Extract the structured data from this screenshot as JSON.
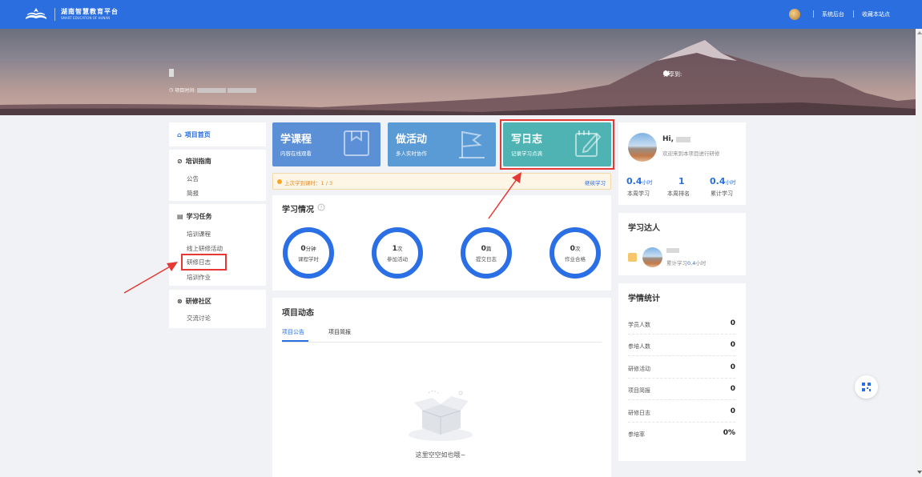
{
  "header": {
    "logo_title": "湖南智慧教育平台",
    "logo_subtitle": "SMART EDUCATION OF HUNAN",
    "links": [
      "系统后台",
      "收藏本站点"
    ]
  },
  "banner": {
    "project_time_label": "项目时间:",
    "share_label": "分享到:"
  },
  "sidebar": {
    "home": "项目首页",
    "sections": [
      {
        "title": "培训指南",
        "items": [
          "公告",
          "简报"
        ]
      },
      {
        "title": "学习任务",
        "items": [
          "培训课程",
          "线上研修活动",
          "研修日志",
          "培训作业"
        ]
      },
      {
        "title": "研修社区",
        "items": [
          "交流讨论"
        ]
      }
    ]
  },
  "tiles": [
    {
      "title": "学课程",
      "subtitle": "内容在线观看",
      "color": "#5b8fd6",
      "icon": "book-icon"
    },
    {
      "title": "做活动",
      "subtitle": "多人实时协作",
      "color": "#5b9bd5",
      "icon": "flag-icon"
    },
    {
      "title": "写日志",
      "subtitle": "记录学习点滴",
      "color": "#4fb3b3",
      "icon": "edit-icon"
    }
  ],
  "notice": {
    "text": "上次学到课时：1 / 3",
    "link": "继续学习"
  },
  "study": {
    "title": "学习情况",
    "stats": [
      {
        "value": "0",
        "unit": "分钟",
        "label": "课程学时"
      },
      {
        "value": "1",
        "unit": "次",
        "label": "参加活动"
      },
      {
        "value": "0",
        "unit": "篇",
        "label": "提交日志"
      },
      {
        "value": "0",
        "unit": "次",
        "label": "作业合格"
      }
    ]
  },
  "feed": {
    "title": "项目动态",
    "tabs": [
      "项目公告",
      "项目简报"
    ],
    "empty": "这里空空如也哦~"
  },
  "profile": {
    "greeting": "Hi,",
    "welcome": "欢迎来到本项目进行研修",
    "metrics": [
      {
        "value": "0.4",
        "unit": "小时",
        "label": "本周学习"
      },
      {
        "value": "1",
        "unit": "",
        "label": "本周排名"
      },
      {
        "value": "0.4",
        "unit": "小时",
        "label": "累计学习"
      }
    ]
  },
  "masters": {
    "title": "学习达人",
    "entry_prefix": "累计学习",
    "entry_value": "0.4",
    "entry_unit": "小时"
  },
  "stats": {
    "title": "学情统计",
    "rows": [
      {
        "label": "学员人数",
        "value": "0"
      },
      {
        "label": "参培人数",
        "value": "0"
      },
      {
        "label": "研修活动",
        "value": "0"
      },
      {
        "label": "项目简报",
        "value": "0"
      },
      {
        "label": "研修日志",
        "value": "0"
      },
      {
        "label": "参培率",
        "value": "0%"
      }
    ]
  }
}
